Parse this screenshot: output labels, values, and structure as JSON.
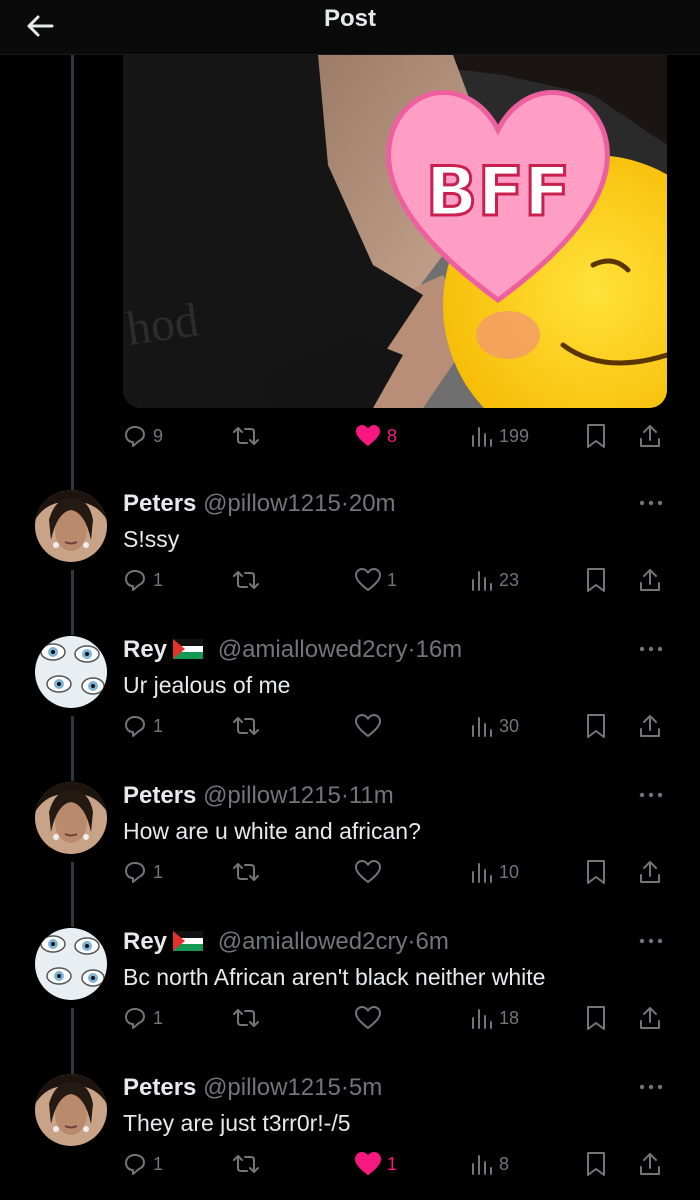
{
  "header": {
    "title": "Post"
  },
  "main_post": {
    "image_sticker_text": "BFF",
    "shirt_text": "hod",
    "stats": {
      "replies": "9",
      "likes": "8",
      "views": "199"
    }
  },
  "replies": [
    {
      "name": "Peters",
      "handle": "@pillow1215",
      "sep": "·",
      "time": "20m",
      "text": "S!ssy",
      "replies": "1",
      "likes": "1",
      "views": "23"
    },
    {
      "name": "Rey",
      "handle": "@amiallowed2cry",
      "sep": "·",
      "time": "16m",
      "text": "Ur jealous of me",
      "replies": "1",
      "likes": "",
      "views": "30"
    },
    {
      "name": "Peters",
      "handle": "@pillow1215",
      "sep": "·",
      "time": "11m",
      "text": "How are u white and african?",
      "replies": "1",
      "likes": "",
      "views": "10"
    },
    {
      "name": "Rey",
      "handle": "@amiallowed2cry",
      "sep": "·",
      "time": "6m",
      "text": "Bc north African aren't black neither white",
      "replies": "1",
      "likes": "",
      "views": "18"
    },
    {
      "name": "Peters",
      "handle": "@pillow1215",
      "sep": "·",
      "time": "5m",
      "text": "They are just t3rr0r!-/5",
      "replies": "1",
      "likes": "1",
      "views": "8"
    }
  ],
  "colors": {
    "background": "#000000",
    "text": "#e7e9ea",
    "muted": "#71767b",
    "like": "#f91880"
  },
  "icons": [
    "back-arrow-icon",
    "reply-icon",
    "repost-icon",
    "heart-icon",
    "views-icon",
    "bookmark-icon",
    "share-icon",
    "more-icon",
    "palestine-flag-icon"
  ]
}
